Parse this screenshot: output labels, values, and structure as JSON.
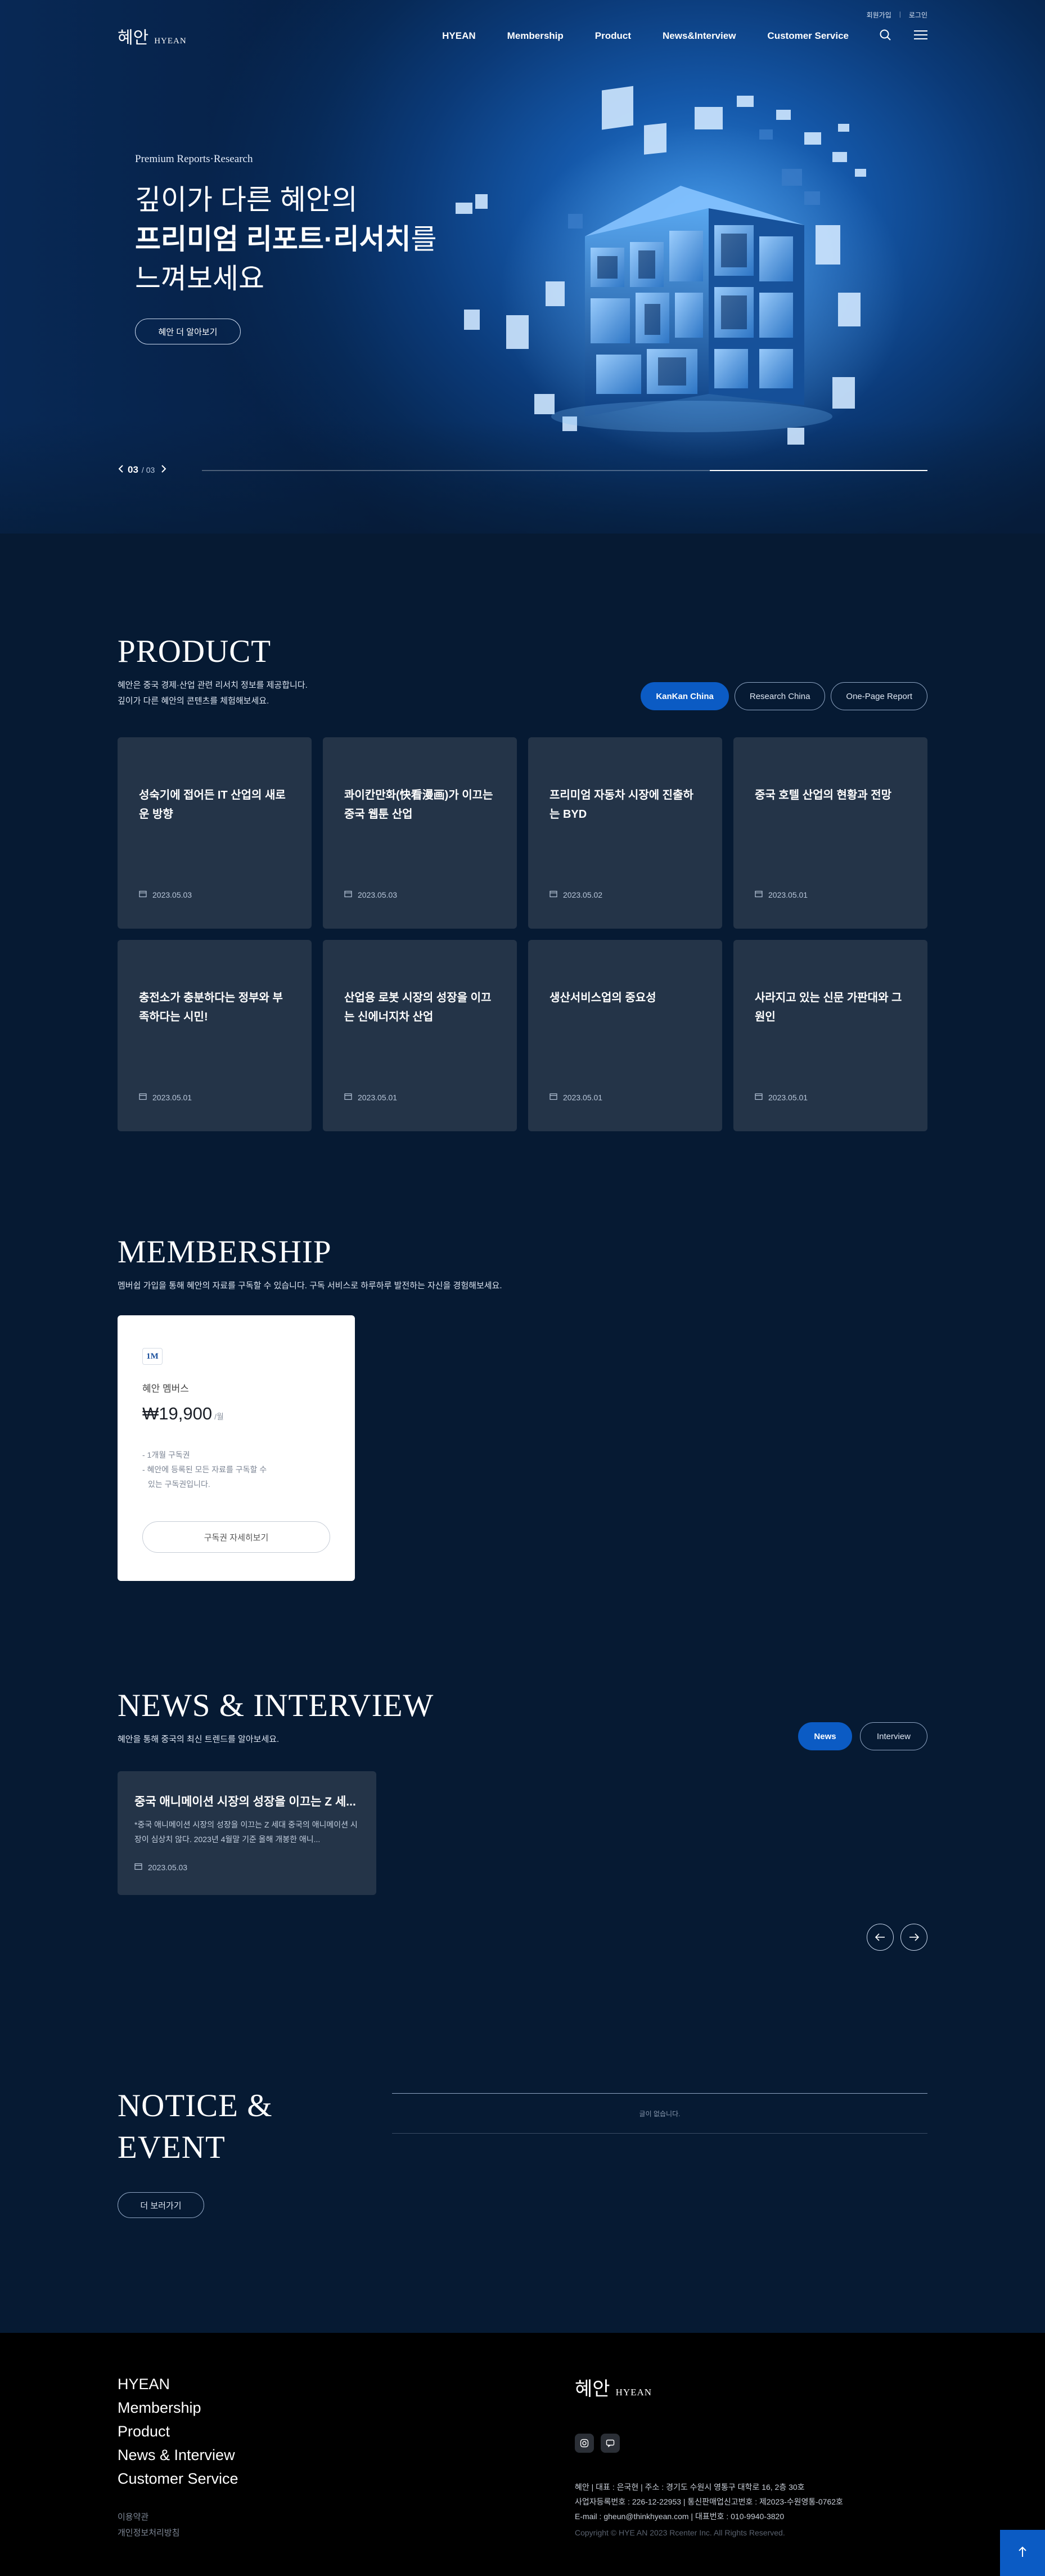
{
  "topbar": {
    "signup": "회원가입",
    "sep": "|",
    "login": "로그인"
  },
  "brand": {
    "ko": "혜안",
    "en": "HYEAN"
  },
  "nav": {
    "items": [
      "HYEAN",
      "Membership",
      "Product",
      "News&Interview",
      "Customer Service"
    ]
  },
  "hero": {
    "eyebrow": "Premium Reports·Research",
    "line1": "깊이가 다른 혜안의",
    "line2_bold": "프리미엄 리포트·리서치",
    "line2_rest": "를",
    "line3": "느껴보세요",
    "button": "혜안 더 알아보기",
    "slide_current": "03",
    "slide_total": "/ 03",
    "progress": 0.3
  },
  "product": {
    "title": "PRODUCT",
    "desc1": "혜안은 중국 경제·산업 관련 리서치 정보를 제공합니다.",
    "desc2": "깊이가 다른 혜안의 콘텐츠를 체험해보세요.",
    "tabs": [
      "KanKan China",
      "Research China",
      "One-Page Report"
    ],
    "cards": [
      {
        "title": "성숙기에 접어든 IT 산업의 새로운 방향",
        "date": "2023.05.03"
      },
      {
        "title": "콰이칸만화(快看漫画)가 이끄는 중국 웹툰 산업",
        "date": "2023.05.03"
      },
      {
        "title": "프리미엄 자동차 시장에 진출하는 BYD",
        "date": "2023.05.02"
      },
      {
        "title": "중국 호텔 산업의 현황과 전망",
        "date": "2023.05.01"
      },
      {
        "title": "충전소가 충분하다는 정부와 부족하다는 시민!",
        "date": "2023.05.01"
      },
      {
        "title": "산업용 로봇 시장의 성장을 이끄는 신에너지차 산업",
        "date": "2023.05.01"
      },
      {
        "title": "생산서비스업의 중요성",
        "date": "2023.05.01"
      },
      {
        "title": "사라지고 있는 신문 가판대와 그 원인",
        "date": "2023.05.01"
      }
    ]
  },
  "membership": {
    "title": "MEMBERSHIP",
    "desc": "멤버쉽 가입을 통해 혜안의 자료를 구독할 수 있습니다. 구독 서비스로 하루하루 발전하는 자신을 경험해보세요.",
    "plan": {
      "badge": "1M",
      "name": "혜안 멤버스",
      "price": "₩19,900",
      "per": "/월",
      "feat1": "- 1개월 구독권",
      "feat2": "- 혜안에 등록된 모든 자료를 구독할 수",
      "feat3": "  있는 구독권입니다.",
      "button": "구독권 자세히보기"
    }
  },
  "news": {
    "title": "NEWS & INTERVIEW",
    "desc": "혜안을 통해 중국의 최신 트렌드를 알아보세요.",
    "tabs": [
      "News",
      "Interview"
    ],
    "card": {
      "title": "중국 애니메이션 시장의 성장을 이끄는 Z 세...",
      "excerpt": "*중국 애니메이션 시장의 성장을 이끄는 Z 세대 중국의 애니메이션 시장이 심상치 않다. 2023년 4월말 기준 올해 개봉한 애니...",
      "date": "2023.05.03"
    }
  },
  "notice": {
    "title1": "NOTICE &",
    "title2": "EVENT",
    "empty": "글이 없습니다.",
    "button": "더 보러가기"
  },
  "footer": {
    "menu": [
      "HYEAN",
      "Membership",
      "Product",
      "News & Interview",
      "Customer Service"
    ],
    "sub1": "이용약관",
    "sub2": "개인정보처리방침",
    "brand_ko": "혜안",
    "brand_en": "HYEAN",
    "line1": "혜안  |  대표 : 은국현  |  주소 : 경기도 수원시 영통구 대학로 16, 2층 30호",
    "line2": "사업자등록번호 : 226-12-22953  |  통신판매업신고번호 : 제2023-수원영통-0762호",
    "line3": "E-mail : gheun@thinkhyean.com  |  대표번호 : 010-9940-3820",
    "copyright": "Copyright © HYE AN 2023 Rcenter Inc. All Rights Reserved."
  },
  "colors": {
    "bg": "#061a33",
    "accent": "#0b5bc4",
    "card": "#243448"
  },
  "icons": {
    "search": "search-icon",
    "menu": "hamburger-icon",
    "calendar": "calendar-icon",
    "instagram": "instagram-icon",
    "chat": "chat-icon",
    "top": "arrow-up-icon"
  }
}
